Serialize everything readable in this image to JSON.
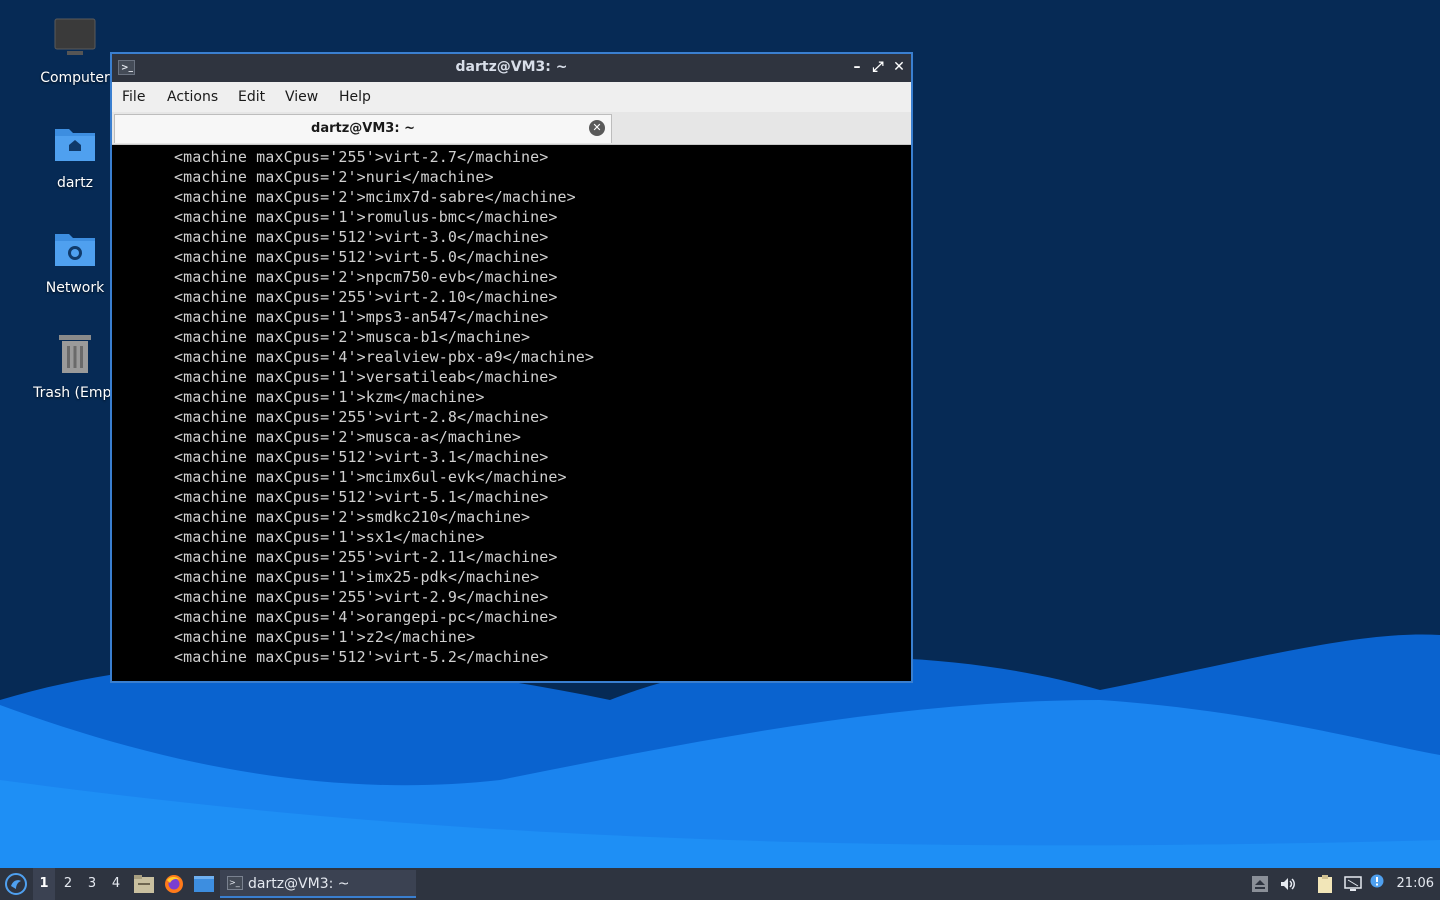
{
  "desktop": {
    "icons": [
      {
        "label": "Computer",
        "icon": "computer-icon"
      },
      {
        "label": "dartz",
        "icon": "home-folder-icon"
      },
      {
        "label": "Network",
        "icon": "network-folder-icon"
      },
      {
        "label": "Trash (Empt",
        "icon": "trash-icon"
      }
    ]
  },
  "window": {
    "title": "dartz@VM3: ~",
    "buttons": {
      "minimize": "–",
      "maximize": "⤢",
      "close": "✕"
    },
    "menu": [
      "File",
      "Actions",
      "Edit",
      "View",
      "Help"
    ],
    "tab": {
      "title": "dartz@VM3: ~",
      "close": "✕"
    },
    "terminal_lines": [
      "<machine maxCpus='255'>virt-2.7</machine>",
      "<machine maxCpus='2'>nuri</machine>",
      "<machine maxCpus='2'>mcimx7d-sabre</machine>",
      "<machine maxCpus='1'>romulus-bmc</machine>",
      "<machine maxCpus='512'>virt-3.0</machine>",
      "<machine maxCpus='512'>virt-5.0</machine>",
      "<machine maxCpus='2'>npcm750-evb</machine>",
      "<machine maxCpus='255'>virt-2.10</machine>",
      "<machine maxCpus='1'>mps3-an547</machine>",
      "<machine maxCpus='2'>musca-b1</machine>",
      "<machine maxCpus='4'>realview-pbx-a9</machine>",
      "<machine maxCpus='1'>versatileab</machine>",
      "<machine maxCpus='1'>kzm</machine>",
      "<machine maxCpus='255'>virt-2.8</machine>",
      "<machine maxCpus='2'>musca-a</machine>",
      "<machine maxCpus='512'>virt-3.1</machine>",
      "<machine maxCpus='1'>mcimx6ul-evk</machine>",
      "<machine maxCpus='512'>virt-5.1</machine>",
      "<machine maxCpus='2'>smdkc210</machine>",
      "<machine maxCpus='1'>sx1</machine>",
      "<machine maxCpus='255'>virt-2.11</machine>",
      "<machine maxCpus='1'>imx25-pdk</machine>",
      "<machine maxCpus='255'>virt-2.9</machine>",
      "<machine maxCpus='4'>orangepi-pc</machine>",
      "<machine maxCpus='1'>z2</machine>",
      "<machine maxCpus='512'>virt-5.2</machine>"
    ]
  },
  "taskbar": {
    "workspaces": [
      "1",
      "2",
      "3",
      "4"
    ],
    "active_workspace": "1",
    "task": {
      "label": "dartz@VM3: ~"
    },
    "clock": "21:06",
    "accent": "#3a7fd0"
  }
}
